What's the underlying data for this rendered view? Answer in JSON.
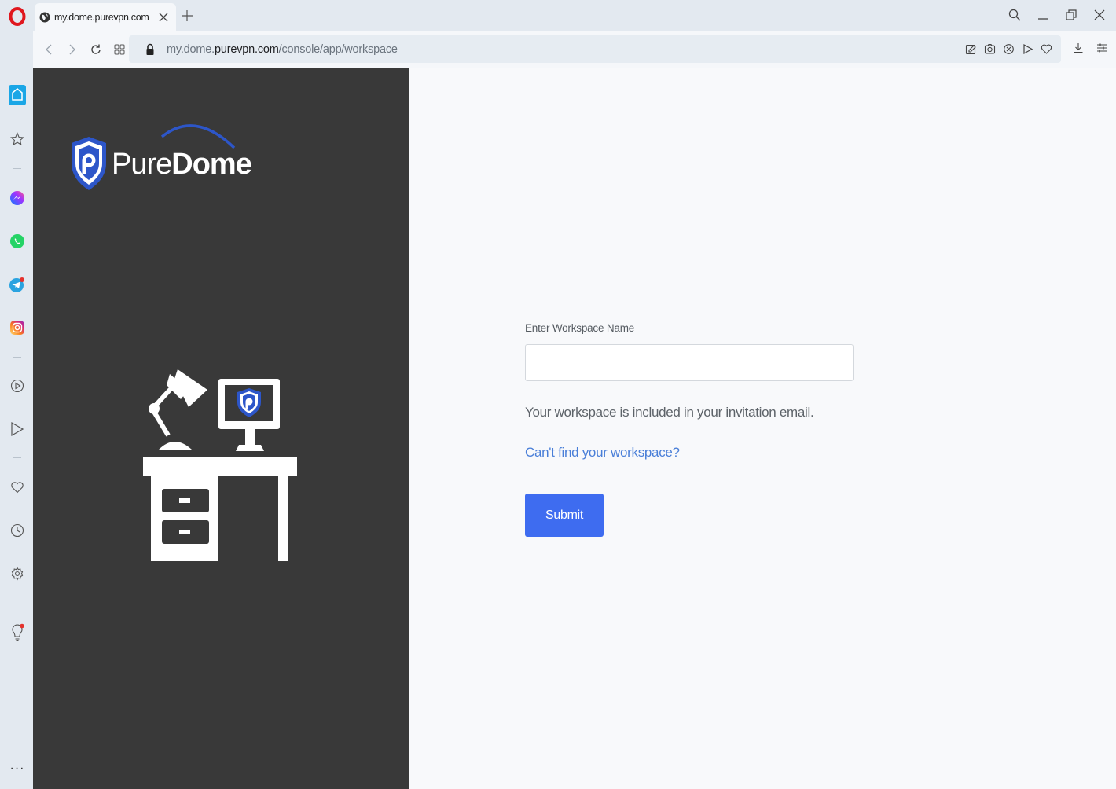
{
  "browser": {
    "tab": {
      "title": "my.dome.purevpn.com"
    },
    "address": {
      "url_prefix": "my.dome.",
      "url_host": "purevpn.com",
      "url_path": "/console/app/workspace"
    },
    "more_label": "···"
  },
  "brand": {
    "name_regular": "Pure",
    "name_bold": "Dome"
  },
  "form": {
    "label": "Enter Workspace Name",
    "input_value": "",
    "input_placeholder": "",
    "hint": "Your workspace is included in your invitation email.",
    "help_link": "Can't find your workspace?",
    "submit_label": "Submit"
  },
  "colors": {
    "left_panel": "#393939",
    "accent": "#3e6cf0",
    "link": "#4a7fd8",
    "brand_blue": "#2d56c9"
  }
}
